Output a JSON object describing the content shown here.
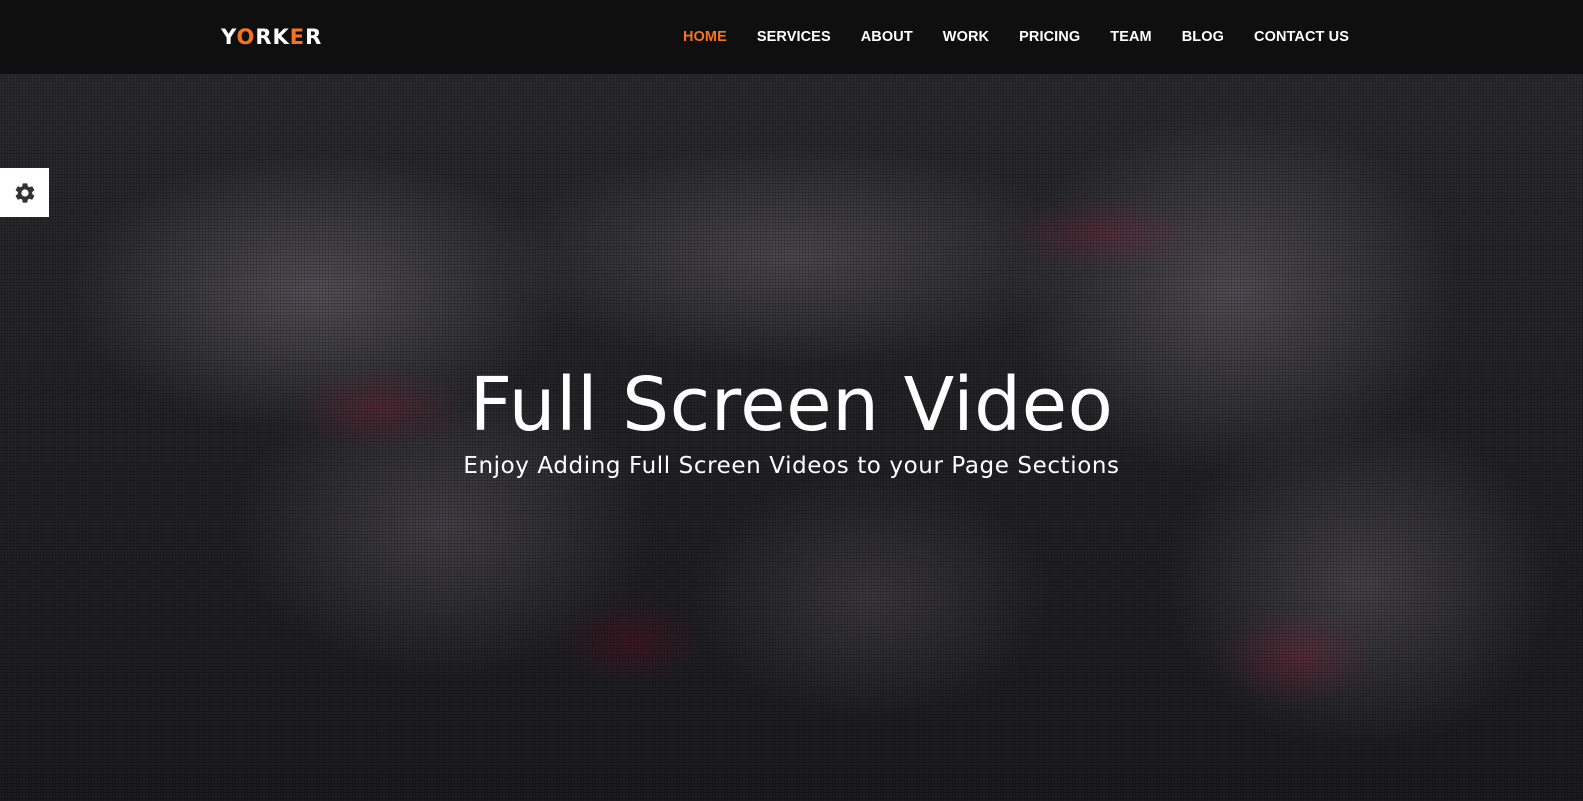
{
  "brand": {
    "parts": [
      {
        "text": "Y",
        "accent": false
      },
      {
        "text": "O",
        "accent": true
      },
      {
        "text": "RK",
        "accent": false
      },
      {
        "text": "E",
        "accent": true
      },
      {
        "text": "R",
        "accent": false
      }
    ]
  },
  "nav": {
    "items": [
      {
        "label": "HOME",
        "active": true
      },
      {
        "label": "SERVICES",
        "active": false
      },
      {
        "label": "ABOUT",
        "active": false
      },
      {
        "label": "WORK",
        "active": false
      },
      {
        "label": "PRICING",
        "active": false
      },
      {
        "label": "TEAM",
        "active": false
      },
      {
        "label": "BLOG",
        "active": false
      },
      {
        "label": "CONTACT US",
        "active": false
      }
    ]
  },
  "hero": {
    "title": "Full Screen Video",
    "subtitle": "Enjoy Adding Full Screen Videos to your Page Sections"
  },
  "settings": {
    "icon": "gear-icon"
  },
  "colors": {
    "accent": "#f5741f",
    "navbar_bg": "#0f0f10",
    "text": "#ffffff"
  }
}
